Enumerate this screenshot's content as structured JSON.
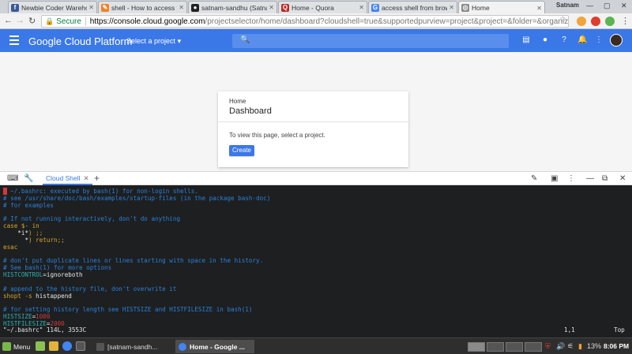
{
  "browser": {
    "tabs": [
      {
        "title": "Newbie Coder Wareho",
        "color": "#3b5998",
        "glyph": "f"
      },
      {
        "title": "shell - How to access yo",
        "color": "#f48024",
        "glyph": "✎"
      },
      {
        "title": "satnam-sandhu (Satnam",
        "color": "#222222",
        "glyph": "●"
      },
      {
        "title": "Home - Quora",
        "color": "#b92b27",
        "glyph": "Q"
      },
      {
        "title": "access shell from brow",
        "color": "#4285f4",
        "glyph": "G"
      },
      {
        "title": "Home",
        "color": "#888888",
        "glyph": "◎"
      }
    ],
    "window_user": "Satnam",
    "secure_label": "Secure",
    "url_host": "https://console.cloud.google.com",
    "url_path": "/projectselector/home/dashboard?cloudshell=true&supportedpurview=project&project=&folder=&organizationId="
  },
  "gcp": {
    "title": "Google Cloud Platform",
    "project_select": "Select a project",
    "card": {
      "breadcrumb": "Home",
      "title": "Dashboard",
      "message": "To view this page, select a project.",
      "create_label": "Create"
    }
  },
  "shell": {
    "tab_label": "Cloud Shell",
    "close_glyph": "✕",
    "add_glyph": "+",
    "lines": [
      [
        [
          "cursor",
          "█"
        ],
        [
          "comment",
          " ~/.bashrc: executed by bash(1) for non-login shells."
        ]
      ],
      [
        [
          "comment",
          "# see /usr/share/doc/bash/examples/startup-files (in the package bash-doc)"
        ]
      ],
      [
        [
          "comment",
          "# for examples"
        ]
      ],
      [
        [
          "plain",
          ""
        ]
      ],
      [
        [
          "comment",
          "# If not running interactively, don't do anything"
        ]
      ],
      [
        [
          "keyword",
          "case"
        ],
        [
          "plain",
          " "
        ],
        [
          "keyword",
          "$- in"
        ]
      ],
      [
        [
          "plain",
          "    "
        ],
        [
          "plain",
          "*i*"
        ],
        [
          "keyword",
          ") ;;"
        ]
      ],
      [
        [
          "plain",
          "      "
        ],
        [
          "plain",
          "*"
        ],
        [
          "keyword",
          ") return;;"
        ]
      ],
      [
        [
          "keyword",
          "esac"
        ]
      ],
      [
        [
          "plain",
          ""
        ]
      ],
      [
        [
          "comment",
          "# don't put duplicate lines or lines starting with space in the history."
        ]
      ],
      [
        [
          "comment",
          "# See bash(1) for more options"
        ]
      ],
      [
        [
          "var",
          "HISTCONTROL"
        ],
        [
          "plain",
          "=ignoreboth"
        ]
      ],
      [
        [
          "plain",
          ""
        ]
      ],
      [
        [
          "comment",
          "# append to the history file, don't overwrite it"
        ]
      ],
      [
        [
          "keyword",
          "shopt"
        ],
        [
          "plain",
          " "
        ],
        [
          "keyword",
          "-s"
        ],
        [
          "plain",
          " histappend"
        ]
      ],
      [
        [
          "plain",
          ""
        ]
      ],
      [
        [
          "comment",
          "# for setting history length see HISTSIZE and HISTFILESIZE in bash(1)"
        ]
      ],
      [
        [
          "var",
          "HISTSIZE"
        ],
        [
          "plain",
          "="
        ],
        [
          "num",
          "1000"
        ]
      ],
      [
        [
          "var",
          "HISTFILESIZE"
        ],
        [
          "plain",
          "="
        ],
        [
          "num",
          "2000"
        ]
      ]
    ],
    "status_file": "\"~/.bashrc\" 114L, 3553C",
    "status_pos": "1,1",
    "status_scroll": "Top"
  },
  "taskbar": {
    "menu_label": "Menu",
    "tasks": [
      {
        "label": "[satnam-sandh...",
        "active": false
      },
      {
        "label": "Home - Google ...",
        "active": true
      }
    ],
    "battery": "13%",
    "clock": "8:06 PM"
  }
}
